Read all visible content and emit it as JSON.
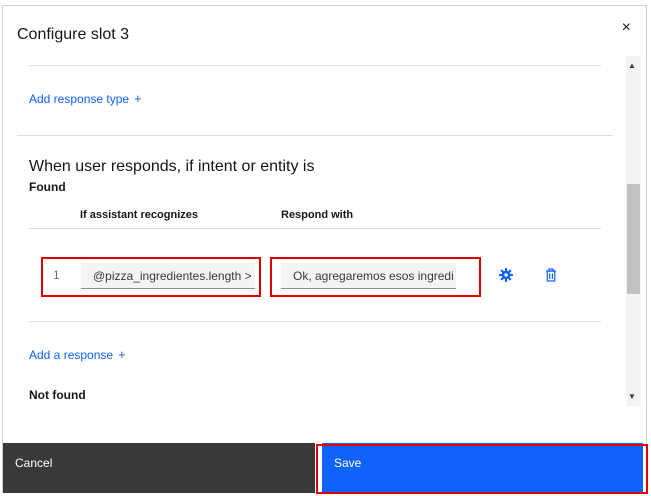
{
  "modal": {
    "title": "Configure slot 3",
    "close_glyph": "×"
  },
  "links": {
    "add_response_type": "Add response type",
    "add_response": "Add a response",
    "plus": "+"
  },
  "section": {
    "heading": "When user responds, if intent or entity is",
    "found_label": "Found",
    "columns": [
      "If assistant recognizes",
      "Respond with"
    ],
    "rows": [
      {
        "number": "1",
        "condition": "@pizza_ingredientes.length >",
        "response": "Ok, agregaremos esos ingredi"
      }
    ],
    "not_found_label": "Not found"
  },
  "scrollbar": {
    "up_glyph": "▲",
    "down_glyph": "▼"
  },
  "icons": {
    "settings": "gear-icon",
    "delete": "trash-icon",
    "close": "close-icon"
  },
  "footer": {
    "cancel_label": "Cancel",
    "save_label": "Save"
  },
  "colors": {
    "primary": "#0f62fe",
    "secondary_button": "#393939",
    "highlight": "#e00000"
  }
}
